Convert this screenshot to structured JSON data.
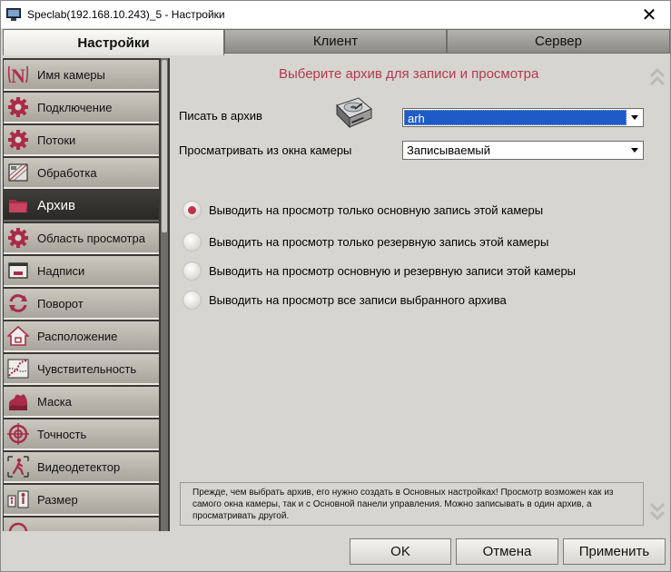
{
  "window": {
    "title": "Speclab(192.168.10.243)_5 - Настройки",
    "close_glyph": "✕"
  },
  "tabs": [
    {
      "label": "Настройки",
      "active": true
    },
    {
      "label": "Клиент",
      "active": false
    },
    {
      "label": "Сервер",
      "active": false
    }
  ],
  "sidebar": {
    "items": [
      {
        "label": "Имя камеры",
        "icon": "camera-name-icon"
      },
      {
        "label": "Подключение",
        "icon": "gear-icon"
      },
      {
        "label": "Потоки",
        "icon": "gear-icon"
      },
      {
        "label": "Обработка",
        "icon": "image-processing-icon"
      },
      {
        "label": "Архив",
        "icon": "folder-icon",
        "active": true
      },
      {
        "label": "Область просмотра",
        "icon": "gear-icon"
      },
      {
        "label": "Надписи",
        "icon": "caption-icon"
      },
      {
        "label": "Поворот",
        "icon": "rotate-icon"
      },
      {
        "label": "Расположение",
        "icon": "house-icon"
      },
      {
        "label": "Чувствительность",
        "icon": "sensitivity-icon"
      },
      {
        "label": "Маска",
        "icon": "mask-icon"
      },
      {
        "label": "Точность",
        "icon": "target-icon"
      },
      {
        "label": "Видеодетектор",
        "icon": "walking-person-icon"
      },
      {
        "label": "Размер",
        "icon": "size-icon"
      }
    ]
  },
  "content": {
    "heading": "Выберите архив для записи и просмотра",
    "write_label": "Писать в архив",
    "view_label": "Просматривать из окна камеры",
    "archive_value": "arh",
    "view_value": "Записываемый",
    "radios": [
      {
        "label": "Выводить на просмотр только основную запись этой камеры",
        "checked": true
      },
      {
        "label": "Выводить на просмотр только резервную запись этой камеры",
        "checked": false
      },
      {
        "label": "Выводить на просмотр основную и резервную записи этой камеры",
        "checked": false
      },
      {
        "label": "Выводить на просмотр все записи выбранного архива",
        "checked": false
      }
    ],
    "note": "Прежде, чем выбрать архив, его нужно создать в Основных настройках! Просмотр возможен как из самого окна камеры, так и с Основной панели управления. Можно записывать в один архив, а просматривать другой."
  },
  "buttons": {
    "ok": "OK",
    "cancel": "Отмена",
    "apply": "Применить"
  },
  "colors": {
    "accent": "#b33a52",
    "active_sidebar": "#2e2d2b",
    "selection": "#1e5bc6"
  }
}
